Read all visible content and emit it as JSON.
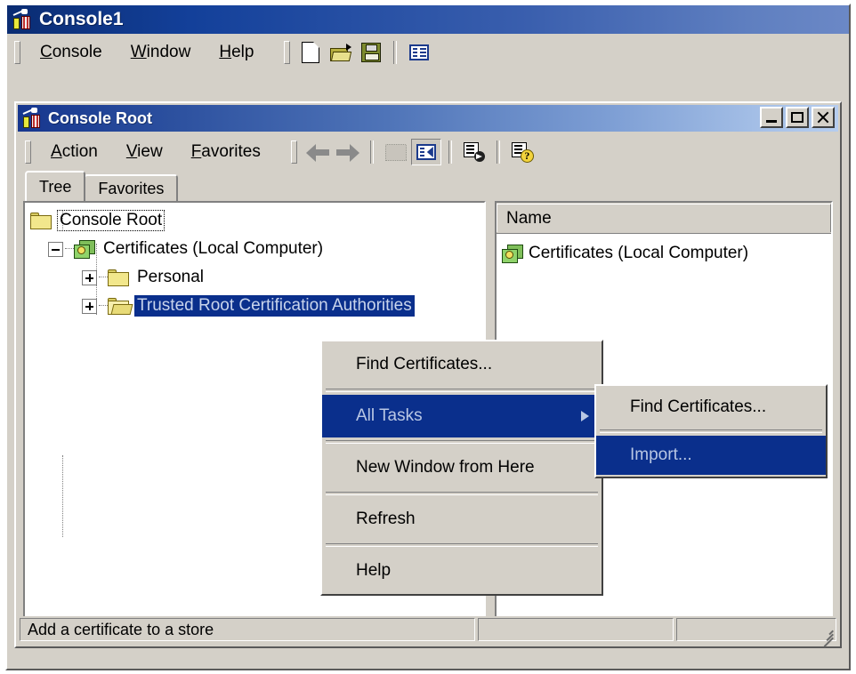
{
  "app": {
    "title": "Console1",
    "icon": "mmc-console-icon",
    "menu": [
      {
        "label": "Console",
        "accel": "C"
      },
      {
        "label": "Window",
        "accel": "W"
      },
      {
        "label": "Help",
        "accel": "H"
      }
    ],
    "toolbar": [
      {
        "name": "new-console-button",
        "icon": "new-document-icon"
      },
      {
        "name": "open-console-button",
        "icon": "open-folder-icon"
      },
      {
        "name": "save-console-button",
        "icon": "save-floppy-icon"
      },
      {
        "name": "new-window-button",
        "icon": "panes-icon"
      }
    ]
  },
  "child": {
    "title": "Console Root",
    "icon": "mmc-console-icon",
    "window_buttons": {
      "minimize": "minimize-button",
      "maximize": "maximize-button",
      "close": "close-button"
    },
    "menu": [
      {
        "label": "Action",
        "accel": "A"
      },
      {
        "label": "View",
        "accel": "V"
      },
      {
        "label": "Favorites",
        "accel": "F"
      }
    ],
    "toolbar": [
      {
        "name": "back-button",
        "icon": "arrow-left-icon"
      },
      {
        "name": "forward-button",
        "icon": "arrow-right-icon"
      },
      {
        "name": "up-one-level-button",
        "icon": "up-folder-icon"
      },
      {
        "name": "show-hide-tree-button",
        "icon": "tree-pane-icon",
        "pressed": true
      },
      {
        "name": "export-list-button",
        "icon": "export-list-icon"
      },
      {
        "name": "help-button",
        "icon": "help-document-icon"
      }
    ],
    "tabs": [
      {
        "label": "Tree",
        "active": true
      },
      {
        "label": "Favorites",
        "active": false
      }
    ]
  },
  "tree": {
    "nodes": [
      {
        "label": "Console Root",
        "icon": "folder-icon",
        "level": 0,
        "expander": "none",
        "state": "focused"
      },
      {
        "label": "Certificates (Local Computer)",
        "icon": "certificate-store-icon",
        "level": 1,
        "expander": "minus",
        "state": "normal"
      },
      {
        "label": "Personal",
        "icon": "folder-icon",
        "level": 2,
        "expander": "plus",
        "state": "normal"
      },
      {
        "label": "Trusted Root Certification Authorities",
        "icon": "folder-open-icon",
        "level": 2,
        "expander": "plus",
        "state": "selected"
      }
    ]
  },
  "list": {
    "columns": [
      "Name"
    ],
    "rows": [
      {
        "name": "Certificates (Local Computer)",
        "icon": "certificate-store-icon"
      }
    ]
  },
  "context_menu": {
    "items": [
      {
        "label": "Find Certificates...",
        "type": "item",
        "highlighted": false,
        "submenu": false
      },
      {
        "type": "separator"
      },
      {
        "label": "All Tasks",
        "type": "item",
        "highlighted": true,
        "submenu": true
      },
      {
        "type": "separator"
      },
      {
        "label": "New Window from Here",
        "type": "item",
        "highlighted": false,
        "submenu": false
      },
      {
        "type": "separator"
      },
      {
        "label": "Refresh",
        "type": "item",
        "highlighted": false,
        "submenu": false
      },
      {
        "type": "separator"
      },
      {
        "label": "Help",
        "type": "item",
        "highlighted": false,
        "submenu": false
      }
    ]
  },
  "submenu": {
    "items": [
      {
        "label": "Find Certificates...",
        "type": "item",
        "highlighted": false
      },
      {
        "type": "separator"
      },
      {
        "label": "Import...",
        "type": "item",
        "highlighted": true
      }
    ]
  },
  "statusbar": {
    "message": "Add a certificate to a store",
    "panel_b": "",
    "panel_c": ""
  },
  "colors": {
    "titlebar_active_start": "#0a2c72",
    "titlebar_active_end": "#6b88c6",
    "selection_blue": "#0a2f8c",
    "selection_text": "#c8d4ec",
    "face": "#d4d0c8",
    "folder_yellow": "#f2e78c",
    "cert_green": "#8fd36a"
  }
}
